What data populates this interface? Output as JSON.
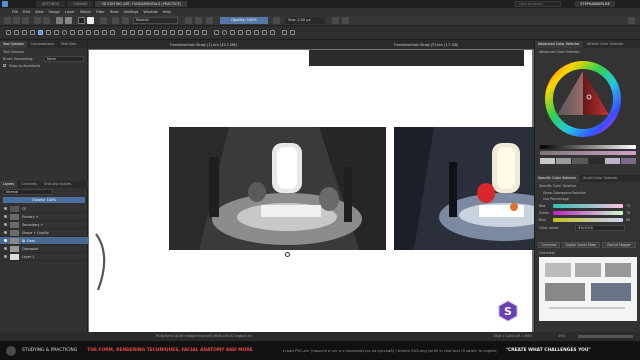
{
  "titlebar": {
    "tabs": [
      "SETTINGS",
      "CANVAS",
      "3D EDITING ART: FUNDAMENTALS (PRACTICE)"
    ],
    "search_placeholder": "VIEW KEYBINDS",
    "user": "STEPHANDEN.BE"
  },
  "menubar": {
    "items": [
      "File",
      "Edit",
      "View",
      "Image",
      "Layer",
      "Select",
      "Filter",
      "Tools",
      "Settings",
      "Window",
      "Help"
    ]
  },
  "toolbar": {
    "blend_mode": "Normal",
    "opacity": "Opacity: 100%",
    "size": "Size: 2.00 px"
  },
  "left_dock": {
    "tabs": [
      "Tool Options",
      "Compositions",
      "Task Sets"
    ],
    "tool_options_title": "Tool Options",
    "smoothing_label": "Brush Smoothing:",
    "smoothing_value": "None",
    "snap_label": "Snap to Assistants",
    "layer_tabs": [
      "Layers",
      "Channels",
      "Grid and Guides"
    ],
    "blend_mode": "Normal",
    "layer_opacity": "Opacity: 100%",
    "layers": [
      {
        "name": "CE",
        "active": false
      },
      {
        "name": "Primary +",
        "active": false
      },
      {
        "name": "Secondary +",
        "active": false
      },
      {
        "name": "Shape + Qualify",
        "active": false
      },
      {
        "name": "BL Final",
        "active": true
      },
      {
        "name": "Overpaint",
        "active": false
      },
      {
        "name": "Layer 1",
        "active": false
      }
    ]
  },
  "canvas": {
    "doc_tabs": [
      "Fundamentals Study (1).kra (43.2 MB)",
      "Fundamentals Study (P).kra (1.7 GB)"
    ],
    "status_left": "RGB/Alpha (8-bit integer/channel)  sRGB-elle-V2-srgbtrc.icc",
    "status_right": "1920 x 1080 (49.1 MiB)",
    "zoom": "49%"
  },
  "right_dock": {
    "top_tabs": [
      "Advanced Color Selector",
      "Artistic Color Selector"
    ],
    "section_title": "Advanced Color Selector",
    "specific_tabs": [
      "Specific Color Selector",
      "Small Color Selector"
    ],
    "specific_title": "Specific Color Selector",
    "show_colorspace": "Show Colorspace Selector",
    "use_percentage": "Use Percentage",
    "channels": [
      {
        "label": "Red",
        "value": "75"
      },
      {
        "label": "Green",
        "value": "70"
      },
      {
        "label": "Blue",
        "value": "80"
      }
    ],
    "color_name_label": "Color name:",
    "color_name_value": "#bcb3c8",
    "bottom_tabs": [
      "Overview",
      "Digital Colors Mixer",
      "Gamut Mapper"
    ],
    "overview_label": "Overview"
  },
  "ticker": {
    "left": "STUDYING & PRACTICING",
    "headline": "THE FORM, RENDERING TECHNIQUES, FACIAL ANATOMY AND MORE",
    "middle": "стрим РУС-анг (пишите в чат и я переключусь на русский) / stream RUS-eng (write in chat and I'll switch to english)",
    "right": "\"CREATE WHAT CHALLENGES YOU\""
  },
  "colors": {
    "accent": "#4b6a93",
    "ticker_red": "#e94747",
    "logo_purple": "#6a3fb0"
  }
}
